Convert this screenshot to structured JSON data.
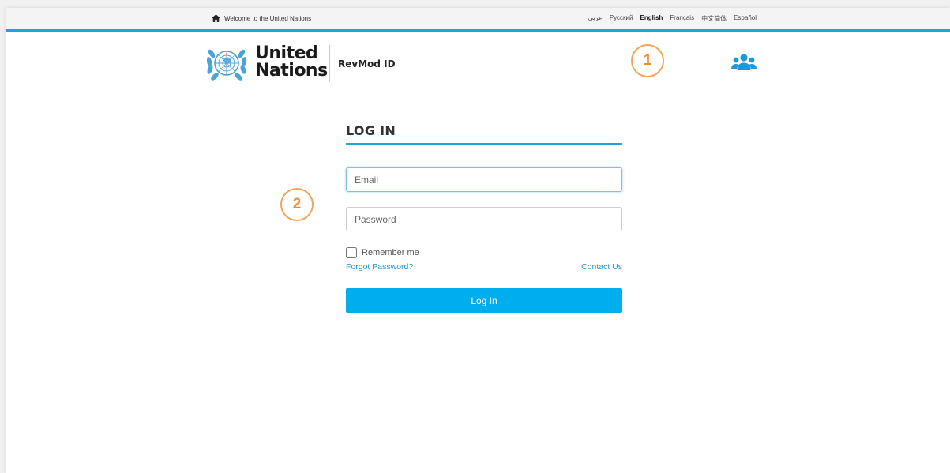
{
  "topbar": {
    "welcome_text": "Welcome to the United Nations",
    "home_icon": "home-icon",
    "languages": [
      "عربي",
      "Русский",
      "English",
      "Français",
      "中文简体",
      "Español"
    ],
    "active_language": "English"
  },
  "header": {
    "org_line1": "United",
    "org_line2": "Nations",
    "product_name": "RevMod ID",
    "emblem_icon": "un-emblem-icon",
    "users_icon": "users-icon"
  },
  "annotations": {
    "first": "1",
    "second": "2"
  },
  "login": {
    "title": "LOG IN",
    "email_placeholder": "Email",
    "email_value": "",
    "password_placeholder": "Password",
    "password_value": "",
    "remember_label": "Remember me",
    "remember_checked": false,
    "forgot_label": "Forgot Password?",
    "contact_label": "Contact Us",
    "submit_label": "Log In"
  },
  "colors": {
    "accent": "#1fa3e0",
    "button": "#00adee",
    "annotation": "#ee8c38",
    "link": "#1a9ad6"
  }
}
